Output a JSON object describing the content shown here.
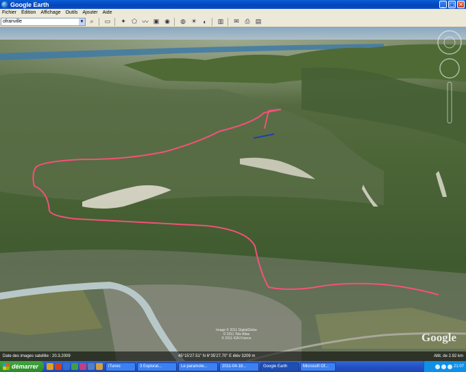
{
  "window": {
    "title": "Google Earth"
  },
  "menu": {
    "items": [
      "Fichier",
      "Édition",
      "Affichage",
      "Outils",
      "Ajouter",
      "Aide"
    ]
  },
  "search": {
    "value": "ofranville"
  },
  "status": {
    "imagery_date": "Date des images satellite : 20.3.2009",
    "coords": "45°15'27.51\" N  6°35'27.70\" E  élév  3209 m",
    "altitude": "Altit. de  2.92 km"
  },
  "map": {
    "logo": "Google",
    "credit": [
      "Image © 2011 DigitalGlobe",
      "© 2011 Tele Atlas",
      "© 2011 IGN France"
    ]
  },
  "taskbar": {
    "start_label": "démarrer",
    "tasks": [
      "iTunes",
      "3 Explorat...",
      "Le paramote...",
      "2011-04-18...",
      "Google Earth",
      "Microsoft Of..."
    ],
    "clock": "21:07"
  }
}
